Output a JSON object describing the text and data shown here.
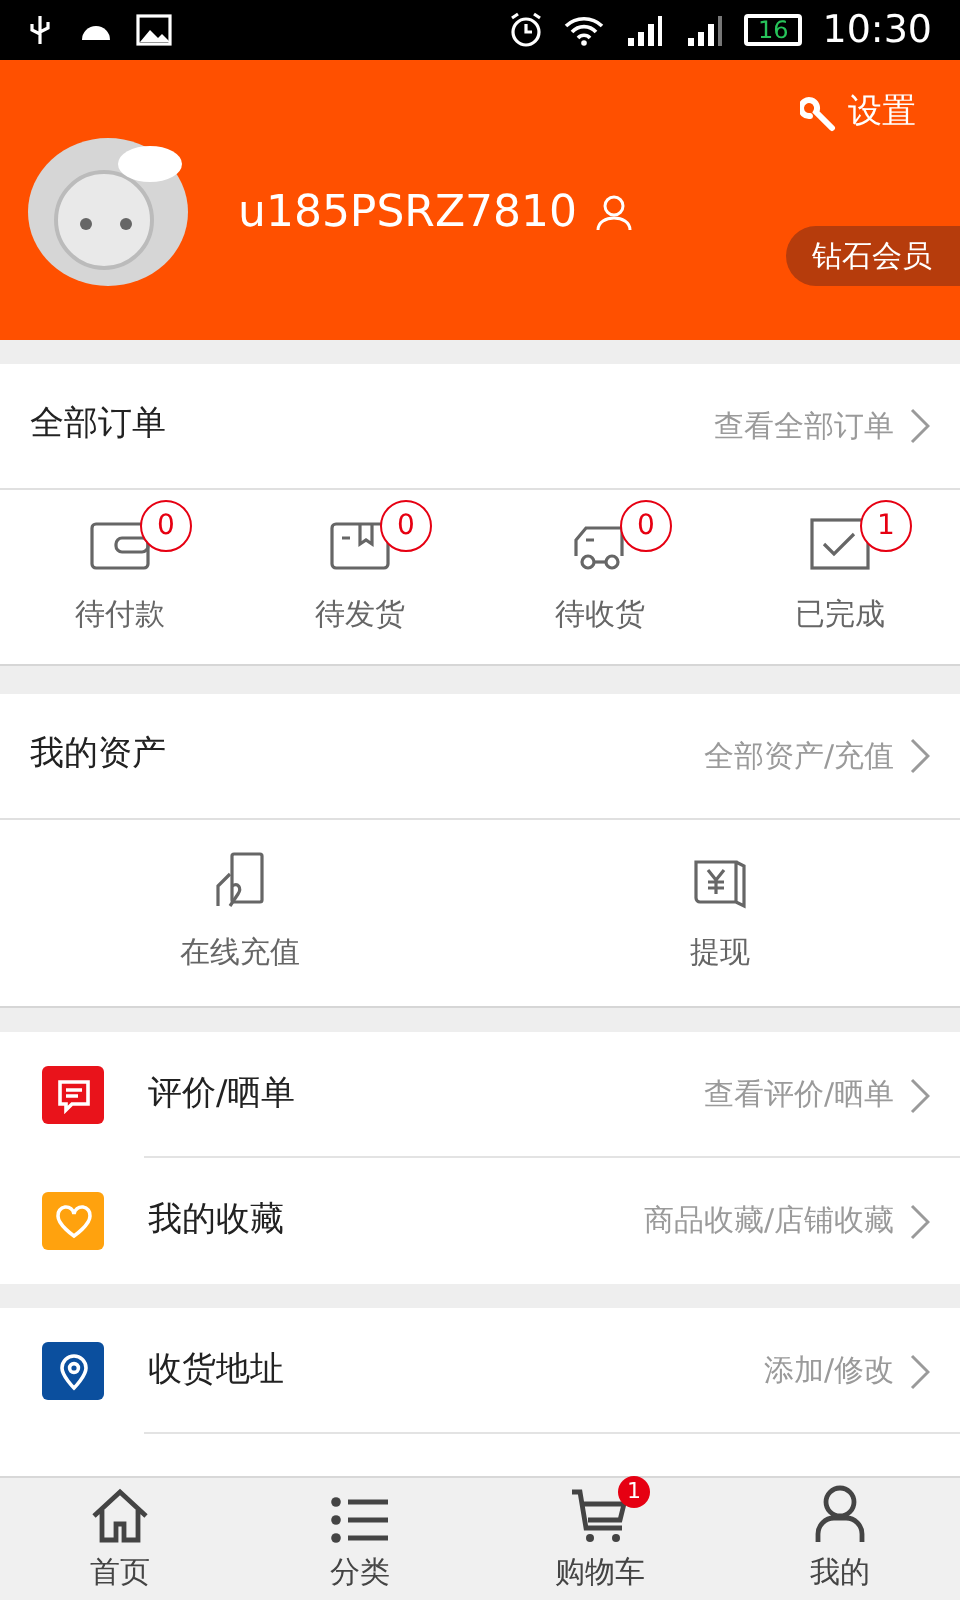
{
  "status_bar": {
    "battery": "16",
    "time": "10:30"
  },
  "profile": {
    "settings": "设置",
    "username": "u185PSRZ7810",
    "member_badge": "钻石会员"
  },
  "orders": {
    "title": "全部订单",
    "link": "查看全部订单",
    "items": [
      {
        "kind": "wallet",
        "label": "待付款",
        "count": "0"
      },
      {
        "kind": "box",
        "label": "待发货",
        "count": "0"
      },
      {
        "kind": "truck",
        "label": "待收货",
        "count": "0"
      },
      {
        "kind": "check",
        "label": "已完成",
        "count": "1"
      }
    ]
  },
  "assets": {
    "title": "我的资产",
    "link": "全部资产/充值",
    "items": [
      {
        "kind": "recharge",
        "label": "在线充值"
      },
      {
        "kind": "withdraw",
        "label": "提现"
      }
    ]
  },
  "menu_groups": [
    [
      {
        "kind": "review",
        "label": "评价/晒单",
        "link": "查看评价/晒单",
        "color": "#e9131b"
      },
      {
        "kind": "favorite",
        "label": "我的收藏",
        "link": "商品收藏/店铺收藏",
        "color": "#ffa20e"
      }
    ],
    [
      {
        "kind": "address",
        "label": "收货地址",
        "link": "添加/修改",
        "color": "#0b4f9e"
      }
    ]
  ],
  "tab_bar": [
    {
      "kind": "home",
      "label": "首页"
    },
    {
      "kind": "list",
      "label": "分类"
    },
    {
      "kind": "cart",
      "label": "购物车",
      "badge": "1"
    },
    {
      "kind": "user",
      "label": "我的"
    }
  ]
}
